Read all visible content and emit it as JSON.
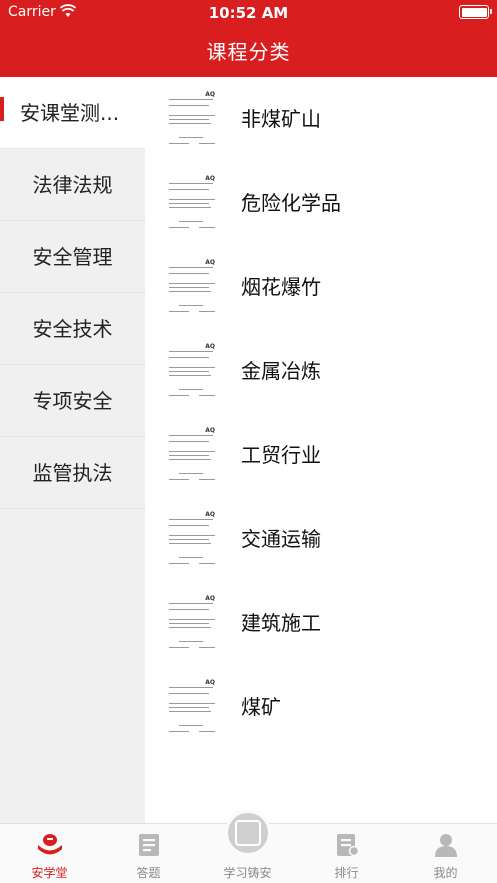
{
  "status_bar": {
    "carrier": "Carrier",
    "time": "10:52 AM"
  },
  "nav": {
    "title": "课程分类"
  },
  "sidebar": {
    "items": [
      {
        "label": "安课堂测..."
      },
      {
        "label": "法律法规"
      },
      {
        "label": "安全管理"
      },
      {
        "label": "安全技术"
      },
      {
        "label": "专项安全"
      },
      {
        "label": "监管执法"
      }
    ],
    "active_index": 0
  },
  "courses": {
    "thumbnail_mark": "AQ",
    "items": [
      {
        "title": "非煤矿山"
      },
      {
        "title": "危险化学品"
      },
      {
        "title": "烟花爆竹"
      },
      {
        "title": "金属冶炼"
      },
      {
        "title": "工贸行业"
      },
      {
        "title": "交通运输"
      },
      {
        "title": "建筑施工"
      },
      {
        "title": "煤矿"
      }
    ]
  },
  "tabbar": {
    "tabs": [
      {
        "label": "安学堂",
        "icon": "home-hand-icon"
      },
      {
        "label": "答题",
        "icon": "quiz-icon"
      },
      {
        "label": "学习铸安",
        "icon": "seal-icon"
      },
      {
        "label": "排行",
        "icon": "ranking-icon"
      },
      {
        "label": "我的",
        "icon": "profile-icon"
      }
    ],
    "active_index": 0
  },
  "colors": {
    "primary": "#d81e1e",
    "sidebar_bg": "#f0f0f0",
    "inactive_tab": "#8a8a8a"
  }
}
